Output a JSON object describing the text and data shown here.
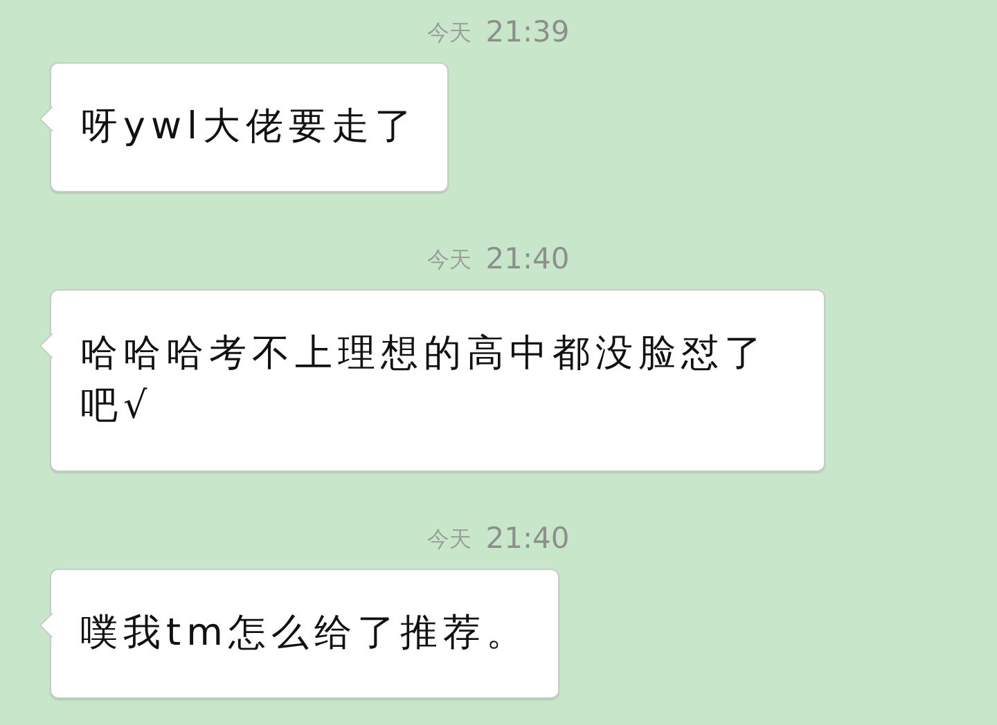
{
  "messages": [
    {
      "day": "今天",
      "time": "21:39",
      "text": "呀ywl大佬要走了"
    },
    {
      "day": "今天",
      "time": "21:40",
      "text": "哈哈哈考不上理想的高中都没脸怼了吧√"
    },
    {
      "day": "今天",
      "time": "21:40",
      "text": "噗我tm怎么给了推荐。"
    }
  ]
}
